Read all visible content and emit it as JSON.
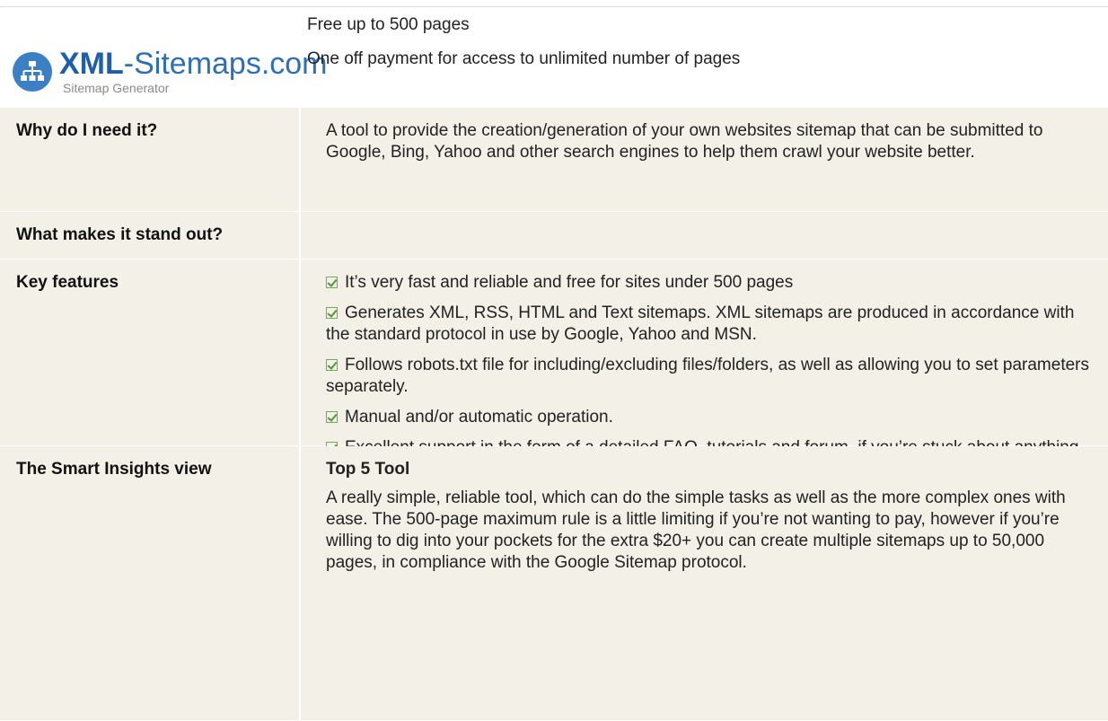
{
  "header": {
    "logo": {
      "brand_bold": "XML",
      "brand_rest": "-Sitemaps.com",
      "tagline": "Sitemap Generator",
      "icon": "sitemap-icon"
    },
    "pricing": [
      "Free up to 500 pages",
      "One off payment for access to unlimited number of pages"
    ]
  },
  "rows": {
    "why": {
      "label": "Why do I need it?",
      "text": "A tool to provide the creation/generation of your own websites sitemap that can be submitted to Google, Bing, Yahoo and other search engines to help them crawl your website better."
    },
    "stand_out": {
      "label": "What makes it stand out?",
      "text": ""
    },
    "key_features": {
      "label": "Key features",
      "items": [
        "It’s very fast and reliable and free for sites under 500 pages",
        "Generates XML, RSS, HTML and Text sitemaps. XML sitemaps are produced in accordance with the standard protocol in use by Google, Yahoo and MSN.",
        "Follows robots.txt file for including/excluding files/folders, as well as allowing you to set parameters separately.",
        "Manual and/or automatic operation.",
        "Excellent support in the form of a detailed FAQ, tutorials and forum, if you’re stuck about anything"
      ]
    },
    "view": {
      "label": "The Smart Insights view",
      "title": "Top 5 Tool",
      "text": "A really simple, reliable tool, which can do the simple tasks as well as the more complex ones with ease. The 500-page maximum rule is a little limiting if you’re not wanting to pay, however if you’re willing to dig into your pockets for the extra $20+ you can create multiple sitemaps up to 50,000 pages, in compliance with the Google Sitemap protocol."
    }
  },
  "colors": {
    "row_background": "#f3f0e7",
    "checkbox": "#6bb04a",
    "brand_blue": "#2f6fb6"
  }
}
